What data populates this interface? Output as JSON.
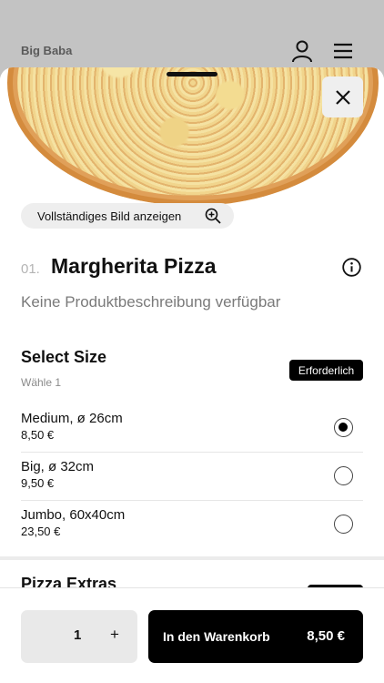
{
  "header": {
    "brand": "Big Baba",
    "icons": [
      "user-icon",
      "menu-icon"
    ]
  },
  "hero": {
    "view_image_label": "Vollständiges Bild anzeigen",
    "icons": [
      "close-icon",
      "zoom-in-icon"
    ]
  },
  "product": {
    "number": "01.",
    "name": "Margherita Pizza",
    "description": "Keine Produktbeschreibung verfügbar",
    "icons": [
      "info-icon"
    ]
  },
  "size_section": {
    "title": "Select Size",
    "hint": "Wähle 1",
    "badge": "Erforderlich",
    "options": [
      {
        "label": "Medium, ø 26cm",
        "price": "8,50 €",
        "selected": true
      },
      {
        "label": "Big, ø 32cm",
        "price": "9,50 €",
        "selected": false
      },
      {
        "label": "Jumbo, 60x40cm",
        "price": "23,50 €",
        "selected": false
      }
    ]
  },
  "extras_section": {
    "title": "Pizza Extras"
  },
  "footer": {
    "quantity": "1",
    "plus": "+",
    "cart_label": "In den Warenkorb",
    "cart_price": "8,50 €"
  },
  "colors": {
    "accent": "#000000",
    "backdrop": "#c3c3c3",
    "muted_text": "#7a7a7a"
  }
}
